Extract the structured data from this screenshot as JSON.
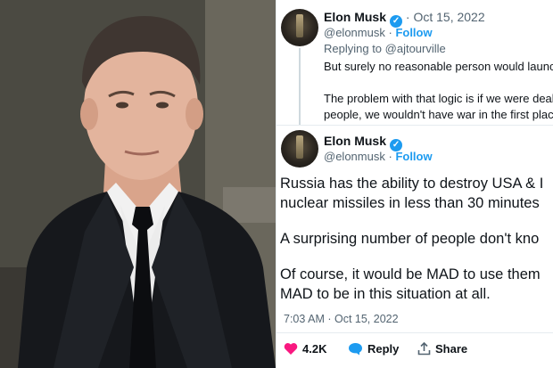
{
  "reply_tweet": {
    "author_name": "Elon Musk",
    "handle_and_follow_sep": "·",
    "date": "Oct 15, 2022",
    "handle": "@elonmusk",
    "follow_label": "Follow",
    "replying_to": "Replying to @ajtourville",
    "lines": [
      "But surely no reasonable person would launch",
      "The problem with that logic is if we were deal",
      "people, we wouldn't have war in the first plac"
    ]
  },
  "main_tweet": {
    "author_name": "Elon Musk",
    "handle": "@elonmusk",
    "separator": "·",
    "follow_label": "Follow",
    "text_lines": [
      "Russia has the ability to destroy USA & I",
      "nuclear missiles in less than 30 minutes",
      "A surprising number of people don't kno",
      "Of course, it would be MAD to use them",
      "MAD to be in this situation at all."
    ],
    "timestamp": "7:03 AM · Oct 15, 2022",
    "likes": "4.2K",
    "reply_label": "Reply",
    "share_label": "Share"
  },
  "colors": {
    "accent": "#1d9bf0",
    "like": "#f91880",
    "text": "#0f1419",
    "muted": "#536471"
  }
}
